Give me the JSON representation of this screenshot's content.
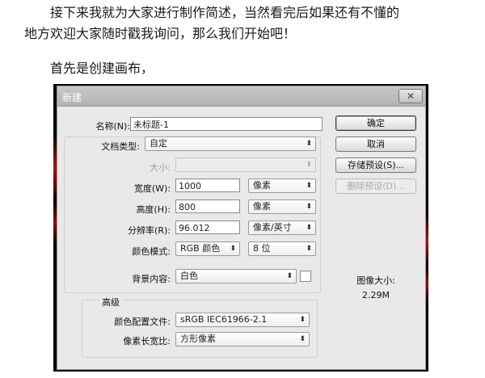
{
  "article": {
    "line1": "接下来我就为大家进行制作简述，当然看完后如果还有不懂的",
    "line2": "地方欢迎大家随时戳我询问，那么我们开始吧！",
    "line3": "首先是创建画布，"
  },
  "dialog": {
    "title": "新建",
    "close": "✕",
    "name": {
      "label": "名称(N):",
      "value": "未标题-1"
    },
    "preset": {
      "label": "文档类型:",
      "value": "自定"
    },
    "size": {
      "label": "大小:",
      "value": ""
    },
    "width": {
      "label": "宽度(W):",
      "value": "1000",
      "unit": "像素"
    },
    "height": {
      "label": "高度(H):",
      "value": "800",
      "unit": "像素"
    },
    "resolution": {
      "label": "分辨率(R):",
      "value": "96.012",
      "unit": "像素/英寸"
    },
    "color_mode": {
      "label": "颜色模式:",
      "value": "RGB 颜色",
      "depth": "8 位"
    },
    "background": {
      "label": "背景内容:",
      "value": "白色"
    },
    "advanced": {
      "heading": "高级",
      "profile": {
        "label": "颜色配置文件:",
        "value": "sRGB IEC61966-2.1"
      },
      "aspect": {
        "label": "像素长宽比:",
        "value": "方形像素"
      }
    },
    "buttons": {
      "ok": "确定",
      "cancel": "取消",
      "save_preset": "存储预设(S)...",
      "delete_preset": "删除预设(D)..."
    },
    "image_size": {
      "label": "图像大小:",
      "value": "2.29M"
    }
  }
}
